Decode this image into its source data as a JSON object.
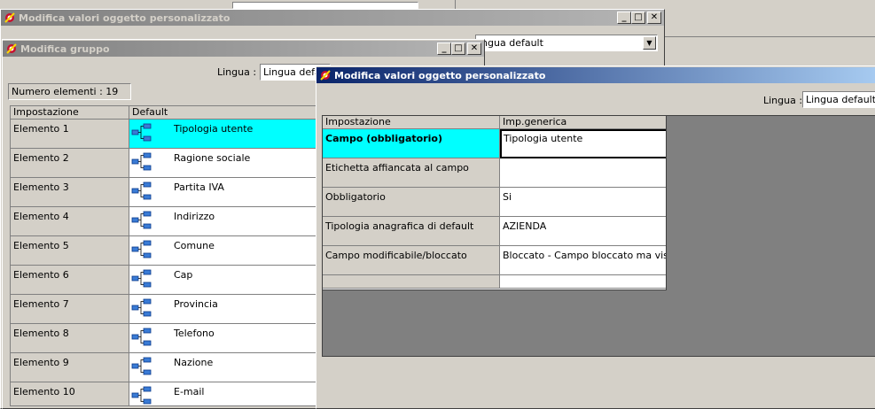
{
  "background_window": {
    "title": "Modifica valori oggetto personalizzato",
    "combo_value": "ingua default"
  },
  "gruppo_window": {
    "title": "Modifica gruppo",
    "lingua_label": "Lingua :",
    "lingua_value": "Lingua default",
    "count_text": "Numero elementi : 19",
    "columns": [
      "Impostazione",
      "Default"
    ],
    "rows": [
      {
        "label": "Elemento 1",
        "value": "Tipologia utente"
      },
      {
        "label": "Elemento 2",
        "value": "Ragione sociale"
      },
      {
        "label": "Elemento 3",
        "value": "Partita IVA"
      },
      {
        "label": "Elemento 4",
        "value": "Indirizzo"
      },
      {
        "label": "Elemento 5",
        "value": "Comune"
      },
      {
        "label": "Elemento 6",
        "value": "Cap"
      },
      {
        "label": "Elemento 7",
        "value": "Provincia"
      },
      {
        "label": "Elemento 8",
        "value": "Telefono"
      },
      {
        "label": "Elemento 9",
        "value": "Nazione"
      },
      {
        "label": "Elemento 10",
        "value": "E-mail"
      }
    ]
  },
  "oggetto_window": {
    "title": "Modifica valori oggetto personalizzato",
    "lingua_label": "Lingua :",
    "lingua_value": "Lingua default",
    "columns": [
      "Impostazione",
      "Imp.generica"
    ],
    "rows": [
      {
        "label": "Campo (obbligatorio)",
        "value": "Tipologia utente"
      },
      {
        "label": "Etichetta affiancata al campo",
        "value": ""
      },
      {
        "label": "Obbligatorio",
        "value": "Si"
      },
      {
        "label": "Tipologia anagrafica di default",
        "value": "AZIENDA"
      },
      {
        "label": "Campo modificabile/bloccato",
        "value": "Bloccato - Campo bloccato ma visibile"
      },
      {
        "label": "",
        "value": ""
      }
    ]
  },
  "colors": {
    "selection": "#00ffff",
    "active_title": "#0a246a",
    "inactive_title": "#808080",
    "empty_area": "#808080"
  }
}
